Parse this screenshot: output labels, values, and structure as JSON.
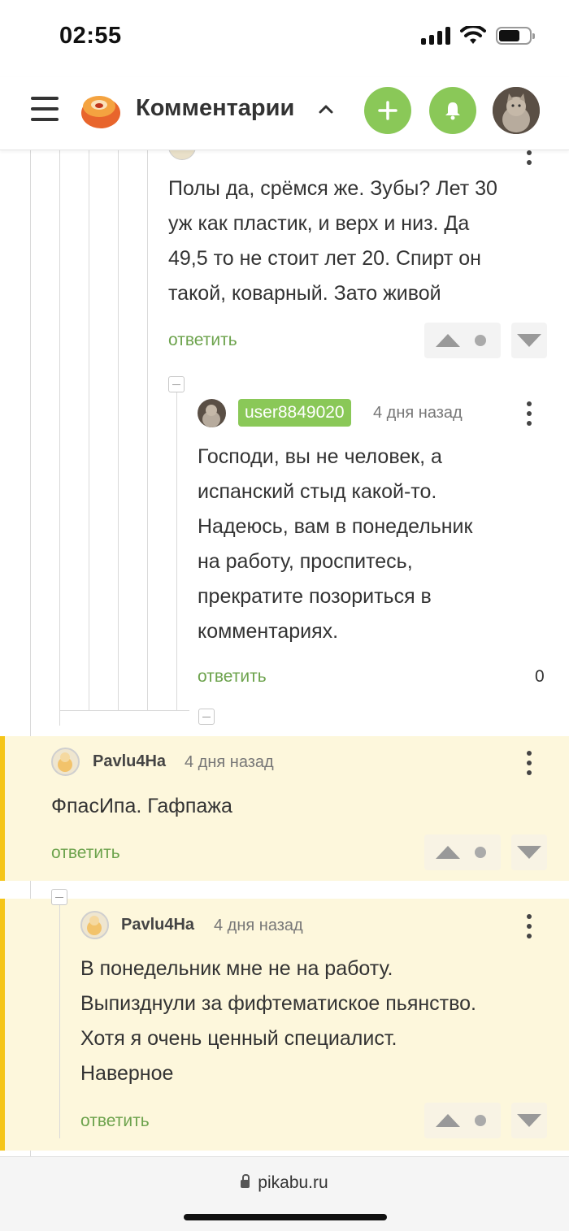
{
  "status_bar": {
    "time": "02:55"
  },
  "header": {
    "title": "Комментарии"
  },
  "comments": [
    {
      "text_lines": [
        "Полы да, срёмся же. Зубы? Лет 30",
        "уж как пластик, и верх и низ. Да",
        "49,5 то не стоит лет 20. Спирт он",
        "такой, коварный. Зато живой"
      ],
      "reply_label": "ответить"
    },
    {
      "username": "user8849020",
      "time_ago": "4 дня назад",
      "text_lines": [
        "Господи, вы не человек, а",
        "испанский стыд какой-то.",
        "Надеюсь, вам в понедельник",
        "на работу, проспитесь,",
        "прекратите позориться в",
        "комментариях."
      ],
      "reply_label": "ответить",
      "rating": "0"
    },
    {
      "username": "Pavlu4Ha",
      "time_ago": "4 дня назад",
      "text_lines": [
        "ФпасИпа. Гафпажа"
      ],
      "reply_label": "ответить"
    },
    {
      "username": "Pavlu4Ha",
      "time_ago": "4 дня назад",
      "text_lines": [
        "В понедельник мне не на работу.",
        "Выпизднули за фифтематиское пьянство.",
        "Хотя я очень ценный специалист.",
        "Наверное"
      ],
      "reply_label": "ответить"
    }
  ],
  "bottom_bar": {
    "url": "pikabu.ru"
  },
  "colors": {
    "accent_green": "#8ac858",
    "highlight": "#fdf7dc",
    "highlight_bar": "#f5c518",
    "reply_green": "#6da34d"
  },
  "icons": [
    "signal-icon",
    "wifi-icon",
    "battery-icon",
    "menu-icon",
    "pikabu-logo",
    "chevron-up-icon",
    "plus-icon",
    "bell-icon",
    "lock-icon"
  ]
}
